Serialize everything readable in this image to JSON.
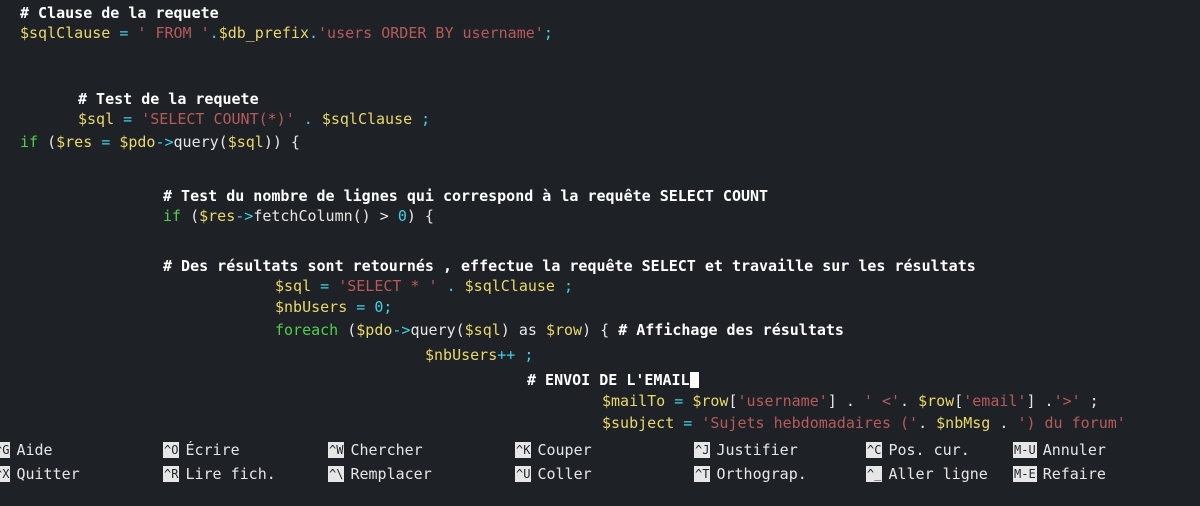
{
  "editor": {
    "lines": [
      [
        {
          "t": "# Clause de la requete",
          "c": "cmt"
        }
      ],
      [
        {
          "t": "$sqlClause",
          "c": "var"
        },
        {
          "t": " = ",
          "c": "op"
        },
        {
          "t": "' FROM '",
          "c": "str"
        },
        {
          "t": ".",
          "c": "op"
        },
        {
          "t": "$db_prefix",
          "c": "var"
        },
        {
          "t": ".",
          "c": "op"
        },
        {
          "t": "'users ORDER BY username'",
          "c": "str"
        },
        {
          "t": ";",
          "c": "op"
        }
      ],
      [],
      [
        {
          "t": "# Test de la requete",
          "c": "cmt"
        }
      ],
      [
        {
          "t": "$sql",
          "c": "var"
        },
        {
          "t": " = ",
          "c": "op"
        },
        {
          "t": "'SELECT COUNT(*)'",
          "c": "str"
        },
        {
          "t": " . ",
          "c": "op"
        },
        {
          "t": "$sqlClause",
          "c": "var"
        },
        {
          "t": " ;",
          "c": "op"
        }
      ],
      [
        {
          "t": "if",
          "c": "kw"
        },
        {
          "t": " (",
          "c": "pl"
        },
        {
          "t": "$res",
          "c": "var"
        },
        {
          "t": " = ",
          "c": "op"
        },
        {
          "t": "$pdo",
          "c": "var"
        },
        {
          "t": "->",
          "c": "op"
        },
        {
          "t": "query(",
          "c": "pl"
        },
        {
          "t": "$sql",
          "c": "var"
        },
        {
          "t": ")) {",
          "c": "pl"
        }
      ],
      [],
      [
        {
          "t": "# Test du nombre de lignes qui correspond à la requête SELECT COUNT",
          "c": "cmt"
        }
      ],
      [
        {
          "t": "if",
          "c": "kw"
        },
        {
          "t": " (",
          "c": "pl"
        },
        {
          "t": "$res",
          "c": "var"
        },
        {
          "t": "->",
          "c": "op"
        },
        {
          "t": "fetchColumn() > ",
          "c": "pl"
        },
        {
          "t": "0",
          "c": "num"
        },
        {
          "t": ") {",
          "c": "pl"
        }
      ],
      [],
      [
        {
          "t": "# Des résultats sont retournés , effectue la requête SELECT et travaille sur les résultats",
          "c": "cmt"
        }
      ],
      [
        {
          "t": "$sql",
          "c": "var"
        },
        {
          "t": " = ",
          "c": "op"
        },
        {
          "t": "'SELECT * '",
          "c": "str"
        },
        {
          "t": " . ",
          "c": "op"
        },
        {
          "t": "$sqlClause",
          "c": "var"
        },
        {
          "t": " ;",
          "c": "op"
        }
      ],
      [
        {
          "t": "$nbUsers",
          "c": "var"
        },
        {
          "t": " = ",
          "c": "op"
        },
        {
          "t": "0",
          "c": "num"
        },
        {
          "t": ";",
          "c": "op"
        }
      ],
      [
        {
          "t": "foreach",
          "c": "kw"
        },
        {
          "t": " (",
          "c": "pl"
        },
        {
          "t": "$pdo",
          "c": "var"
        },
        {
          "t": "->",
          "c": "op"
        },
        {
          "t": "query(",
          "c": "pl"
        },
        {
          "t": "$sql",
          "c": "var"
        },
        {
          "t": ") as ",
          "c": "pl"
        },
        {
          "t": "$row",
          "c": "var"
        },
        {
          "t": ") { ",
          "c": "pl"
        },
        {
          "t": "# Affichage des résultats",
          "c": "cmt"
        }
      ],
      [
        {
          "t": "$nbUsers",
          "c": "var"
        },
        {
          "t": "++ ;",
          "c": "op"
        }
      ],
      [
        {
          "t": "# ENVOI DE L'EMAIL",
          "c": "cmt"
        }
      ],
      [
        {
          "t": "$mailTo",
          "c": "var"
        },
        {
          "t": " = ",
          "c": "op"
        },
        {
          "t": "$row",
          "c": "var"
        },
        {
          "t": "[",
          "c": "pl"
        },
        {
          "t": "'username'",
          "c": "str"
        },
        {
          "t": "] . ",
          "c": "pl"
        },
        {
          "t": "' <'",
          "c": "str"
        },
        {
          "t": ". ",
          "c": "pl"
        },
        {
          "t": "$row",
          "c": "var"
        },
        {
          "t": "[",
          "c": "pl"
        },
        {
          "t": "'email'",
          "c": "str"
        },
        {
          "t": "] .",
          "c": "pl"
        },
        {
          "t": "'>'",
          "c": "str"
        },
        {
          "t": " ;",
          "c": "pl"
        }
      ],
      [
        {
          "t": "$subject",
          "c": "var"
        },
        {
          "t": " = ",
          "c": "op"
        },
        {
          "t": "'Sujets hebdomadaires ('",
          "c": "str"
        },
        {
          "t": ". ",
          "c": "pl"
        },
        {
          "t": "$nbMsg",
          "c": "var"
        },
        {
          "t": " . ",
          "c": "pl"
        },
        {
          "t": "') du forum'",
          "c": "str"
        }
      ]
    ]
  },
  "shortcuts": {
    "row1": [
      {
        "key": "^G",
        "label": "Aide"
      },
      {
        "key": "^O",
        "label": "Écrire"
      },
      {
        "key": "^W",
        "label": "Chercher"
      },
      {
        "key": "^K",
        "label": "Couper"
      },
      {
        "key": "^J",
        "label": "Justifier"
      },
      {
        "key": "^C",
        "label": "Pos. cur."
      },
      {
        "key": "M-U",
        "label": "Annuler"
      }
    ],
    "row2": [
      {
        "key": "^X",
        "label": "Quitter"
      },
      {
        "key": "^R",
        "label": "Lire fich."
      },
      {
        "key": "^\\",
        "label": "Remplacer"
      },
      {
        "key": "^U",
        "label": "Coller"
      },
      {
        "key": "^T",
        "label": "Orthograp."
      },
      {
        "key": "^_",
        "label": "Aller ligne"
      },
      {
        "key": "M-E",
        "label": "Refaire"
      }
    ]
  },
  "colors": {
    "background": "#1e2126",
    "comment": "#ffffff",
    "variable": "#e9d86b",
    "string": "#b85a5a",
    "keyword": "#4fd04a",
    "operator": "#3fd2e6"
  }
}
